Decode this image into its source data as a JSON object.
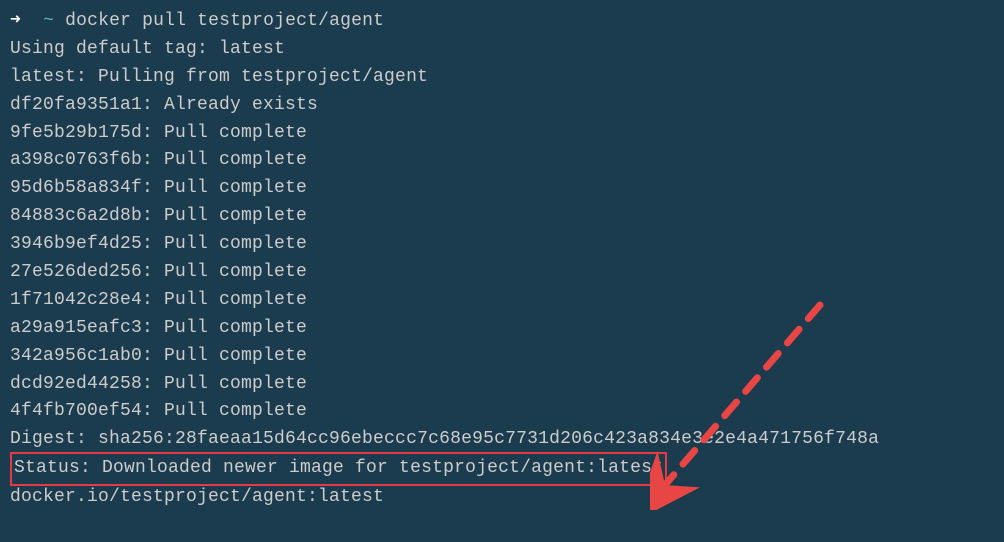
{
  "prompt": {
    "arrow": "➜",
    "dir": "~",
    "command": "docker pull testproject/agent"
  },
  "output": {
    "lines": [
      "Using default tag: latest",
      "latest: Pulling from testproject/agent",
      "df20fa9351a1: Already exists",
      "9fe5b29b175d: Pull complete",
      "a398c0763f6b: Pull complete",
      "95d6b58a834f: Pull complete",
      "84883c6a2d8b: Pull complete",
      "3946b9ef4d25: Pull complete",
      "27e526ded256: Pull complete",
      "1f71042c28e4: Pull complete",
      "a29a915eafc3: Pull complete",
      "342a956c1ab0: Pull complete",
      "dcd92ed44258: Pull complete",
      "4f4fb700ef54: Pull complete",
      "Digest: sha256:28faeaa15d64cc96ebeccc7c68e95c7731d206c423a834e3e2e4a471756f748a"
    ],
    "status_line": "Status: Downloaded newer image for testproject/agent:latest",
    "final_line": "docker.io/testproject/agent:latest"
  },
  "annotation": {
    "highlight_color": "#e63946",
    "arrow_color": "#e63946"
  }
}
